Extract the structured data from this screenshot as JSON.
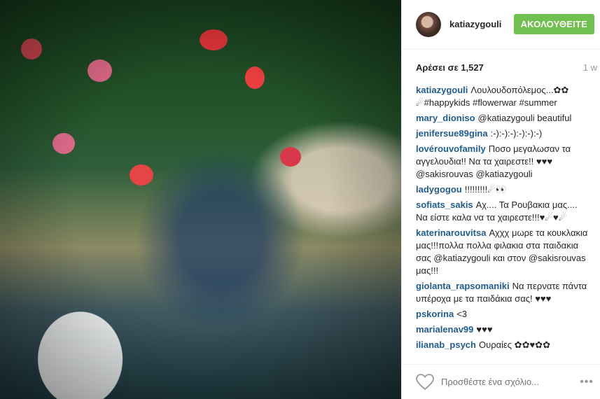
{
  "header": {
    "username": "katiazygouli",
    "follow_label": "ΑΚΟΛΟΥΘΕΙΤΕ"
  },
  "meta": {
    "likes": "Αρέσει σε 1,527",
    "time": "1 w"
  },
  "comments": [
    {
      "user": "katiazygouli",
      "text": "Λουλουδοπόλεμος...✿✿ ☄#happykids #flowerwar #summer"
    },
    {
      "user": "mary_dioniso",
      "text": "@katiazygouli beautiful"
    },
    {
      "user": "jenifersue89gina",
      "text": ":-):-):-):-):-):-)"
    },
    {
      "user": "lovérouvofamily",
      "text": "Ποσο μεγαλωσαν τα αγγελουδια!! Να τα χαιρεστε!! ♥♥♥ @sakisrouvas @katiazygouli"
    },
    {
      "user": "ladygogou",
      "text": "!!!!!!!!!☄👀"
    },
    {
      "user": "sofiats_sakis",
      "text": "Αχ.... Τα Ρουβακια μας.... Να είστε καλα να τα χαιρεστε!!!♥☄♥☄"
    },
    {
      "user": "katerinarouvitsa",
      "text": "Αχχχ μωρε τα κουκλακια μας!!!πολλα πολλα φιλακια στα παιδακια σας @katiazygouli και στον @sakisrouvas μας!!!"
    },
    {
      "user": "giolanta_rapsomaniki",
      "text": "Να περνατε πάντα υπέροχα με τα παιδάκια σας! ♥♥♥"
    },
    {
      "user": "pskorina",
      "text": "<3"
    },
    {
      "user": "marialenav99",
      "text": "♥♥♥"
    },
    {
      "user": "ilianab_psych",
      "text": "Ουραίες ✿✿♥✿✿"
    }
  ],
  "footer": {
    "placeholder": "Προσθέστε ένα σχόλιο...",
    "more": "•••"
  },
  "colors": {
    "follow": "#70c050",
    "link": "#1f5c8f"
  }
}
